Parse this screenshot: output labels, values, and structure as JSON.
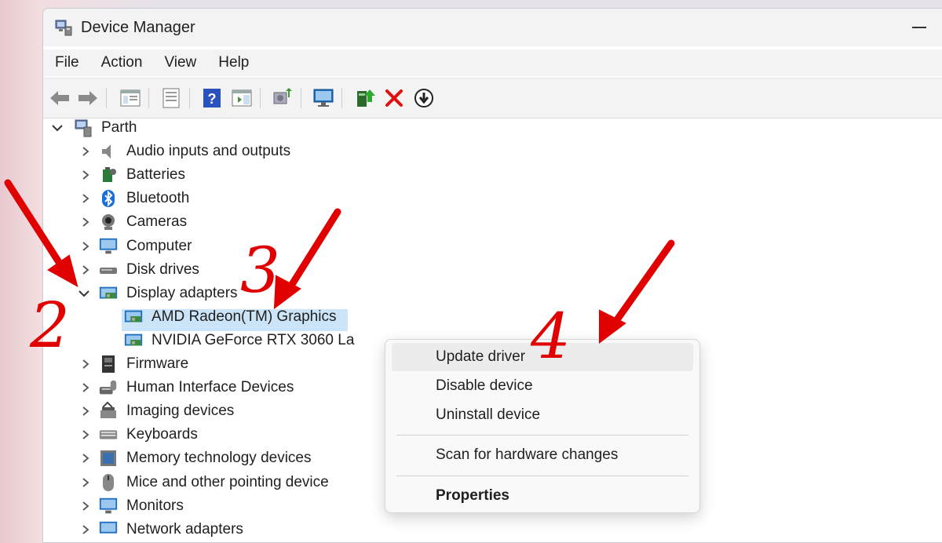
{
  "window": {
    "title": "Device Manager",
    "icons": {
      "app": "device-manager-icon",
      "minimize": "minimize-icon"
    }
  },
  "menu": [
    "File",
    "Action",
    "View",
    "Help"
  ],
  "toolbar": {
    "buttons": [
      "back-arrow-icon",
      "forward-arrow-icon",
      "show-hide-console-tree-icon",
      "properties-icon",
      "help-icon",
      "action-pane-icon",
      "scan-hardware-icon",
      "monitor-icon",
      "update-driver-icon",
      "uninstall-x-icon",
      "disable-device-icon"
    ]
  },
  "tree": {
    "root": {
      "label": "Parth",
      "icon": "computer-root-icon",
      "expanded": true
    },
    "categories": [
      {
        "label": "Audio inputs and outputs",
        "icon": "speaker-icon"
      },
      {
        "label": "Batteries",
        "icon": "battery-icon"
      },
      {
        "label": "Bluetooth",
        "icon": "bluetooth-icon"
      },
      {
        "label": "Cameras",
        "icon": "camera-icon"
      },
      {
        "label": "Computer",
        "icon": "computer-icon"
      },
      {
        "label": "Disk drives",
        "icon": "disk-drive-icon"
      },
      {
        "label": "Display adapters",
        "icon": "display-adapter-icon",
        "expanded": true,
        "children": [
          {
            "label": "AMD Radeon(TM) Graphics",
            "icon": "display-adapter-icon",
            "selected": true
          },
          {
            "label": "NVIDIA GeForce RTX 3060 La",
            "icon": "display-adapter-icon"
          }
        ]
      },
      {
        "label": "Firmware",
        "icon": "firmware-icon"
      },
      {
        "label": "Human Interface Devices",
        "icon": "hid-icon"
      },
      {
        "label": "Imaging devices",
        "icon": "scanner-icon"
      },
      {
        "label": "Keyboards",
        "icon": "keyboard-icon"
      },
      {
        "label": "Memory technology devices",
        "icon": "memory-card-icon"
      },
      {
        "label": "Mice and other pointing device",
        "icon": "mouse-icon"
      },
      {
        "label": "Monitors",
        "icon": "monitor-icon"
      },
      {
        "label": "Network adapters",
        "icon": "network-adapter-icon"
      }
    ]
  },
  "context_menu": {
    "items": [
      {
        "label": "Update driver",
        "highlighted": true
      },
      {
        "label": "Disable device"
      },
      {
        "label": "Uninstall device"
      },
      {
        "label": "Scan for hardware changes"
      },
      {
        "label": "Properties",
        "bold": true
      }
    ]
  },
  "annotations": {
    "color": "#e00000",
    "labels": [
      "2",
      "3",
      "4"
    ]
  },
  "colors": {
    "selection": "#cce4f7",
    "annotation_red": "#e00000"
  }
}
